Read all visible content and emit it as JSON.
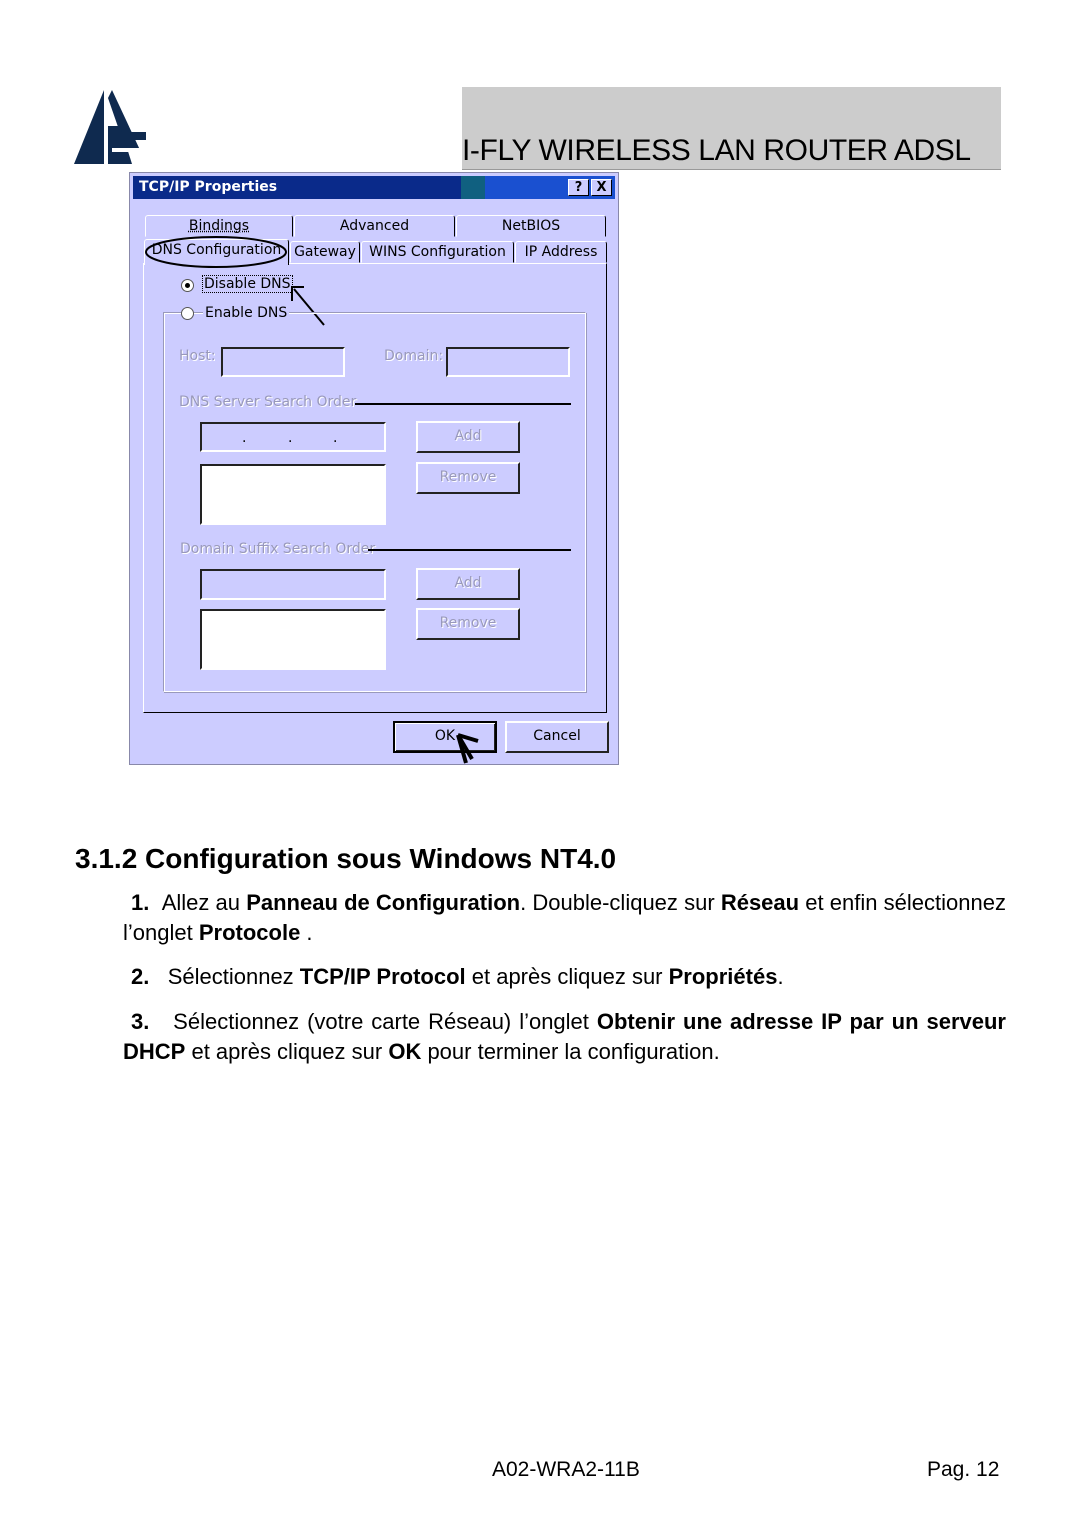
{
  "header": {
    "logo": "atlantis-logo-icon",
    "title": "I-FLY WIRELESS LAN ROUTER ADSL"
  },
  "dialog": {
    "title": "TCP/IP Properties",
    "help_button": "?",
    "close_button": "X",
    "tabs_row1": [
      {
        "label": "Bindings"
      },
      {
        "label": "Advanced"
      },
      {
        "label": "NetBIOS"
      }
    ],
    "tabs_row2": [
      {
        "label": "DNS Configuration",
        "active": true,
        "annotated": true
      },
      {
        "label": "Gateway"
      },
      {
        "label": "WINS Configuration"
      },
      {
        "label": "IP Address"
      }
    ],
    "disable_dns": {
      "label": "Disable DNS",
      "checked": true
    },
    "enable_dns": {
      "label": "Enable DNS",
      "checked": false
    },
    "host_label": "Host:",
    "host_value": "",
    "domain_label": "Domain:",
    "domain_value": "",
    "dns_search_order_label": "DNS Server Search Order",
    "dns_ip_value": ". . .",
    "dns_add_button": "Add",
    "dns_remove_button": "Remove",
    "suffix_search_order_label": "Domain Suffix Search Order",
    "suffix_value": "",
    "suffix_add_button": "Add",
    "suffix_remove_button": "Remove",
    "ok_button": "OK",
    "cancel_button": "Cancel",
    "annotation_arrows": [
      "arrow-to-disable-dns",
      "arrow-to-ok"
    ]
  },
  "content": {
    "section_heading": "3.1.2 Configuration sous Windows NT4.0",
    "steps": [
      {
        "number": "1.",
        "parts": [
          {
            "t": "Allez au ",
            "b": false
          },
          {
            "t": "Panneau de Configuration",
            "b": true
          },
          {
            "t": ". Double-cliquez sur  ",
            "b": false
          },
          {
            "t": "Réseau",
            "b": true
          },
          {
            "t": " et enfin sélectionnez l’onglet  ",
            "b": false
          },
          {
            "t": "Protocole",
            "b": true
          },
          {
            "t": " .",
            "b": false
          }
        ]
      },
      {
        "number": "2.",
        "parts": [
          {
            "t": "Sélectionnez ",
            "b": false
          },
          {
            "t": "TCP/IP Protocol",
            "b": true
          },
          {
            "t": " et après cliquez sur ",
            "b": false
          },
          {
            "t": "Propriétés",
            "b": true
          },
          {
            "t": ".",
            "b": false
          }
        ]
      },
      {
        "number": "3.",
        "parts": [
          {
            "t": "Sélectionnez (votre carte Réseau) l’onglet  ",
            "b": false
          },
          {
            "t": "Obtenir une adresse IP par un serveur DHCP",
            "b": true
          },
          {
            "t": " et après cliquez sur ",
            "b": false
          },
          {
            "t": "OK",
            "b": true
          },
          {
            "t": " pour terminer la configuration.",
            "b": false
          }
        ]
      }
    ]
  },
  "footer": {
    "doc_code": "A02-WRA2-11B",
    "page": "Pag. 12"
  }
}
